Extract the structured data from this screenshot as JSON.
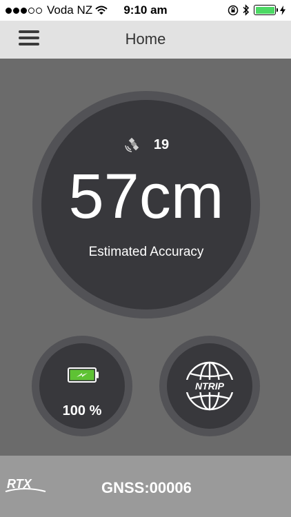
{
  "status_bar": {
    "carrier": "Voda NZ",
    "time": "9:10 am",
    "signal_strength_dots": 3,
    "signal_total_dots": 5,
    "battery_level": 1.0
  },
  "nav": {
    "title": "Home"
  },
  "accuracy": {
    "satellites": "19",
    "value": "57cm",
    "label": "Estimated Accuracy"
  },
  "battery": {
    "percent": "100 %",
    "icon": "battery-charging-icon"
  },
  "ntrip": {
    "icon": "ntrip-globe-icon",
    "label": "NTRIP"
  },
  "footer": {
    "logo_text": "RTX",
    "gnss": "GNSS:00006"
  },
  "colors": {
    "background": "#6b6b6b",
    "circle": "#38383c",
    "ring": "#525256",
    "nav": "#e2e2e2",
    "footer": "#9a9a9a",
    "battery_green": "#5ec234"
  }
}
